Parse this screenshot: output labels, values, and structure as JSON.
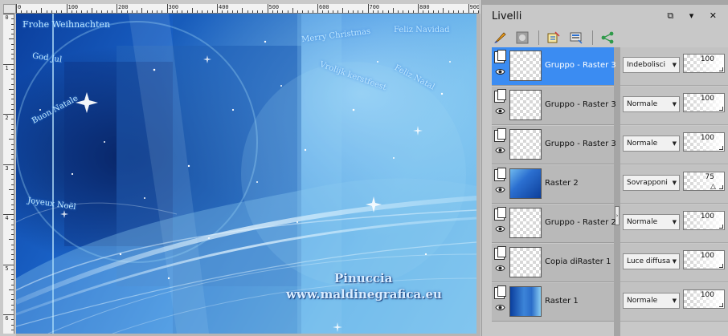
{
  "canvas": {
    "ruler_h_labels": [
      "0",
      "100",
      "200",
      "300",
      "400",
      "500",
      "600",
      "700",
      "800",
      "900"
    ],
    "ruler_v_labels": [
      "0",
      "1",
      "2",
      "3",
      "4",
      "5",
      "6"
    ],
    "greetings": [
      "Frohe Weihnachten",
      "God Jul",
      "Buon Natale",
      "Joyeux Noël",
      "Merry Christmas",
      "Feliz Navidad",
      "Vrolijk kerstfeest",
      "Feliz Natal"
    ],
    "watermark_line1": "Pinuccia",
    "watermark_line2": "www.maldinegrafica.eu"
  },
  "panel": {
    "title": "Livelli",
    "controls": "⧉ ▾ ✕",
    "toolbar_icons": [
      "brush-icon",
      "mask-icon",
      "layer-properties-icon",
      "layer-blend-icon",
      "share-icon"
    ],
    "layers": [
      {
        "name": "Gruppo - Raster 3",
        "blend": "Indebolisci",
        "opacity": "100",
        "selected": true,
        "thumb": "transparent"
      },
      {
        "name": "Gruppo - Raster 3",
        "blend": "Normale",
        "opacity": "100",
        "selected": false,
        "thumb": "transparent"
      },
      {
        "name": "Gruppo - Raster 3",
        "blend": "Normale",
        "opacity": "100",
        "selected": false,
        "thumb": "transparent"
      },
      {
        "name": "Raster 2",
        "blend": "Sovrapponi",
        "opacity": "75",
        "selected": false,
        "thumb": "blue"
      },
      {
        "name": "Gruppo - Raster 2",
        "blend": "Normale",
        "opacity": "100",
        "selected": false,
        "thumb": "transparent"
      },
      {
        "name": "Copia diRaster 1",
        "blend": "Luce diffusa",
        "opacity": "100",
        "selected": false,
        "thumb": "transparent"
      },
      {
        "name": "Raster 1",
        "blend": "Normale",
        "opacity": "100",
        "selected": false,
        "thumb": "image"
      }
    ]
  },
  "colors": {
    "selected_layer": "#3b8cf2",
    "image_dark_blue": "#0b3f9d",
    "image_light_blue": "#7cc3ee"
  }
}
